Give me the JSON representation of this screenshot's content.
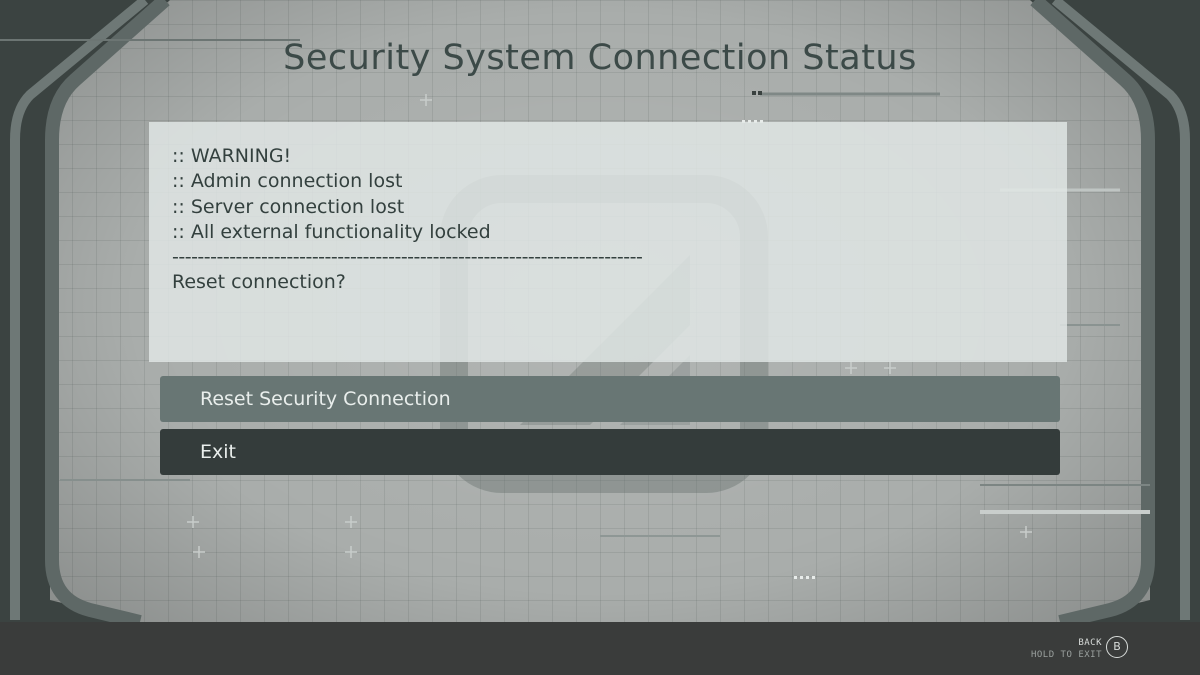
{
  "page_title": "Security System Connection Status",
  "message_lines": [
    ":: WARNING!",
    ":: Admin connection lost",
    ":: Server connection lost",
    ":: All external functionality locked",
    "--------------------------------------------------------------------------",
    "Reset connection?"
  ],
  "options": [
    {
      "label": "Reset Security Connection",
      "state": "highlighted"
    },
    {
      "label": "Exit",
      "state": "normal"
    }
  ],
  "footer": {
    "back_label": "BACK",
    "hold_label": "HOLD TO EXIT",
    "button_glyph": "B",
    "button_icon": "b-button-icon"
  },
  "colors": {
    "highlight": "#687674",
    "normal": "#343c3b",
    "title": "#3c4a48"
  }
}
